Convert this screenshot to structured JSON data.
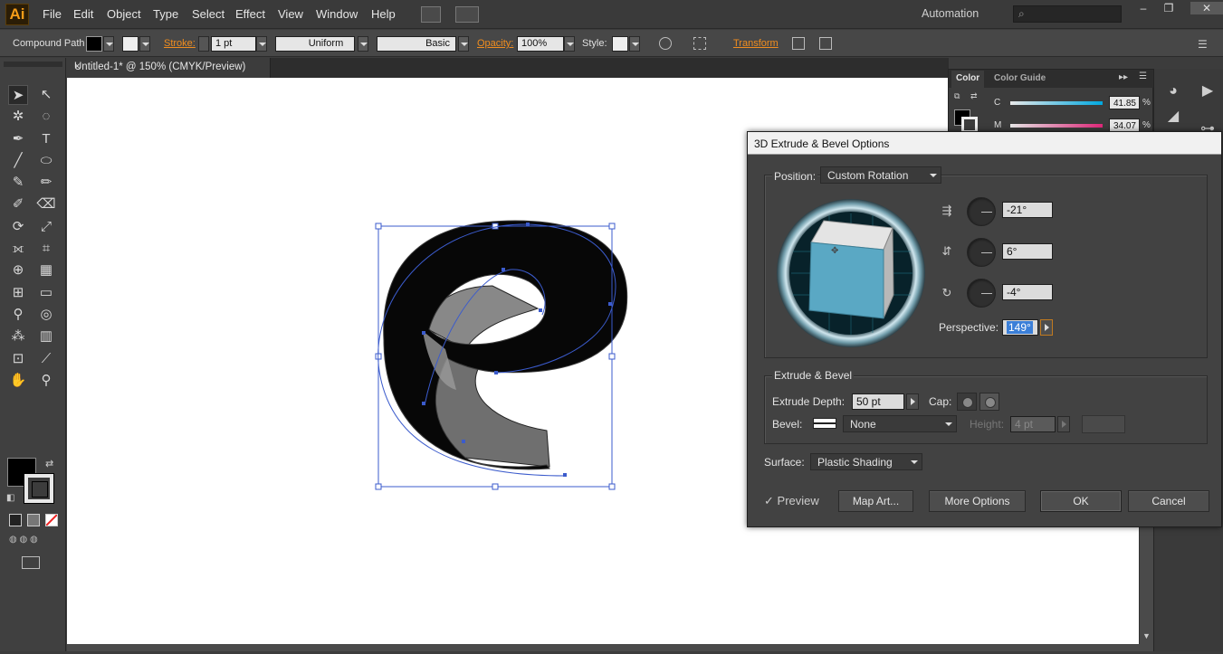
{
  "menubar": {
    "logo": "Ai",
    "items": [
      "File",
      "Edit",
      "Object",
      "Type",
      "Select",
      "Effect",
      "View",
      "Window",
      "Help"
    ],
    "workspace": "Automation",
    "search_placeholder": ""
  },
  "controlbar": {
    "selection_type": "Compound Path",
    "stroke_label": "Stroke:",
    "stroke_weight": "1 pt",
    "profile": "Uniform",
    "brush": "Basic",
    "opacity_label": "Opacity:",
    "opacity_value": "100%",
    "style_label": "Style:",
    "transform_label": "Transform"
  },
  "document_tab": {
    "title": "Untitled-1* @ 150% (CMYK/Preview)",
    "close": "×"
  },
  "color_panel": {
    "tabs": [
      "Color",
      "Color Guide"
    ],
    "sliders": [
      {
        "label": "C",
        "value": "41.85",
        "unit": "%"
      },
      {
        "label": "M",
        "value": "34.07",
        "unit": "%"
      }
    ]
  },
  "dialog": {
    "title": "3D Extrude & Bevel Options",
    "position_label": "Position:",
    "position_value": "Custom Rotation",
    "rotation_x": "-21°",
    "rotation_y": "6°",
    "rotation_z": "-4°",
    "perspective_label": "Perspective:",
    "perspective_value": "149°",
    "extrude_section": "Extrude & Bevel",
    "extrude_depth_label": "Extrude Depth:",
    "extrude_depth_value": "50 pt",
    "cap_label": "Cap:",
    "bevel_label": "Bevel:",
    "bevel_value": "None",
    "height_label": "Height:",
    "height_value": "4 pt",
    "surface_label": "Surface:",
    "surface_value": "Plastic Shading",
    "preview_label": "Preview",
    "preview_checked": true,
    "buttons": {
      "map_art": "Map Art...",
      "more_options": "More Options",
      "ok": "OK",
      "cancel": "Cancel"
    }
  },
  "colors": {
    "accent": "#f08d1f",
    "cube_face": "#5aa8c4",
    "selection": "#3b5bcc"
  }
}
